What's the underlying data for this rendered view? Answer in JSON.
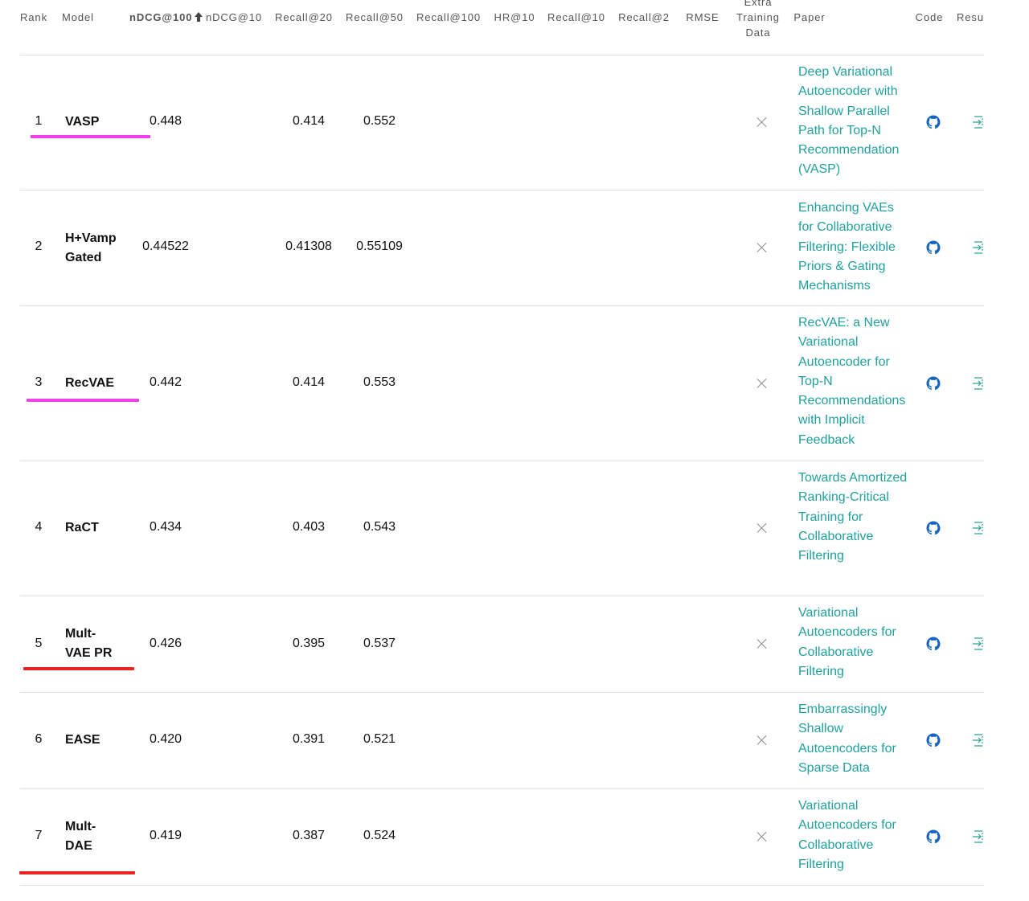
{
  "header": {
    "rank": "Rank",
    "model": "Model",
    "ndcg100": "nDCG@100",
    "ndcg10": "nDCG@10",
    "recall20": "Recall@20",
    "recall50": "Recall@50",
    "recall100": "Recall@100",
    "hr10": "HR@10",
    "recall10": "Recall@10",
    "recall2": "Recall@2",
    "rmse": "RMSE",
    "extra_line1": "Extra",
    "extra_line2": "Training",
    "extra_line3": "Data",
    "paper": "Paper",
    "code": "Code",
    "results": "Resu"
  },
  "colors": {
    "link": "#21a0a0",
    "github": "#1565c0",
    "results_icon": "#2aa198",
    "underline_magenta": "#f040e8",
    "underline_red": "#e8261e"
  },
  "rows": [
    {
      "rank": "1",
      "model": "VASP",
      "ndcg100": "0.448",
      "recall20": "0.414",
      "recall50": "0.552",
      "paper": "Deep Variational Autoencoder with Shallow Parallel Path for Top-N Recommendation (VASP)",
      "extra_data": "none",
      "code_icon": "github-icon",
      "results_icon": "results-icon",
      "underline": "magenta"
    },
    {
      "rank": "2",
      "model": "H+Vamp Gated",
      "ndcg100": "0.44522",
      "recall20": "0.41308",
      "recall50": "0.55109",
      "paper": "Enhancing VAEs for Collaborative Filtering: Flexible Priors & Gating Mechanisms",
      "extra_data": "none",
      "code_icon": "github-icon",
      "results_icon": "results-icon",
      "underline": ""
    },
    {
      "rank": "3",
      "model": "RecVAE",
      "ndcg100": "0.442",
      "recall20": "0.414",
      "recall50": "0.553",
      "paper": "RecVAE: a New Variational Autoencoder for Top-N Recommendations with Implicit Feedback",
      "extra_data": "none",
      "code_icon": "github-icon",
      "results_icon": "results-icon",
      "underline": "magenta"
    },
    {
      "rank": "4",
      "model": "RaCT",
      "ndcg100": "0.434",
      "recall20": "0.403",
      "recall50": "0.543",
      "paper": "Towards Amortized Ranking-Critical Training for Collaborative Filtering",
      "extra_data": "none",
      "code_icon": "github-icon",
      "results_icon": "results-icon",
      "underline": ""
    },
    {
      "rank": "5",
      "model": "Mult-VAE PR",
      "ndcg100": "0.426",
      "recall20": "0.395",
      "recall50": "0.537",
      "paper": "Variational Autoencoders for Collaborative Filtering",
      "extra_data": "none",
      "code_icon": "github-icon",
      "results_icon": "results-icon",
      "underline": "red"
    },
    {
      "rank": "6",
      "model": "EASE",
      "ndcg100": "0.420",
      "recall20": "0.391",
      "recall50": "0.521",
      "paper": "Embarrassingly Shallow Autoencoders for Sparse Data",
      "extra_data": "none",
      "code_icon": "github-icon",
      "results_icon": "results-icon",
      "underline": ""
    },
    {
      "rank": "7",
      "model": "Mult-DAE",
      "ndcg100": "0.419",
      "recall20": "0.387",
      "recall50": "0.524",
      "paper": "Variational Autoencoders for Collaborative Filtering",
      "extra_data": "none",
      "code_icon": "github-icon",
      "results_icon": "results-icon",
      "underline": "red"
    }
  ]
}
